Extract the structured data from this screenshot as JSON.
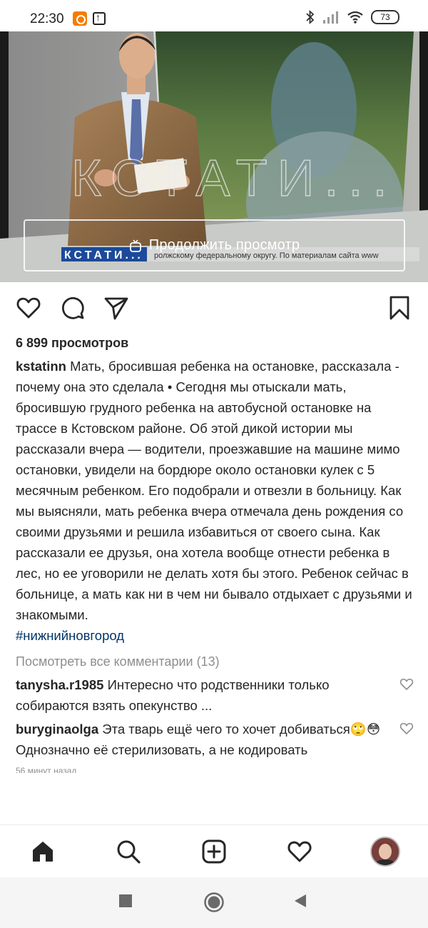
{
  "status_bar": {
    "time": "22:30",
    "battery": "73",
    "icons": [
      "app-notification-icon",
      "upload-icon",
      "bluetooth-icon",
      "signal-icon",
      "wifi-icon",
      "battery-icon"
    ]
  },
  "video": {
    "continue_label": "Продолжить просмотр",
    "watermark": "КСТАТИ...",
    "ticker_brand": "КСТАТИ...",
    "ticker_text": "ролжскому федеральному округу. По материалам сайта www"
  },
  "actions": {
    "icons": [
      "heart-icon",
      "comment-icon",
      "share-icon",
      "bookmark-icon"
    ]
  },
  "post": {
    "views": "6 899 просмотров",
    "username": "kstatinn",
    "caption": "Мать, бросившая ребенка на остановке, рассказала - почему она это сделала • Сегодня мы отыскали мать, бросившую грудного ребенка на автобусной остановке на трассе в Кстовском районе. Об этой дикой истории мы рассказали вчера — водители, проезжавшие на машине мимо остановки, увидели на бордюре около остановки кулек с 5 месячным ребенком. Его подобрали и отвезли в больницу. Как мы выясняли, мать ребенка вчера отмечала день рождения со своими друзьями и решила избавиться от своего сына. Как рассказали ее друзья, она хотела вообще отнести ребенка в лес, но ее уговорили не делать хотя бы этого. Ребенок сейчас в больнице, а мать как ни в чем ни бывало отдыхает с друзьями и знакомыми.",
    "hashtag": "#нижнийновгород",
    "view_all_comments": "Посмотреть все комментарии (13)",
    "comments": [
      {
        "user": "tanysha.r1985",
        "text": "Интересно что родственники только собираются взять опекунство ..."
      },
      {
        "user": "buryginaolga",
        "text": "Эта тварь ещё чего то хочет добиваться🙄😳 Однозначно её стерилизовать, а не кодировать"
      }
    ],
    "timestamp": "56 минут назад"
  },
  "bottom_nav": {
    "icons": [
      "home-icon",
      "search-icon",
      "add-post-icon",
      "activity-heart-icon",
      "profile-avatar"
    ]
  },
  "system_nav": {
    "icons": [
      "recents-square-icon",
      "home-circle-icon",
      "back-triangle-icon"
    ]
  },
  "colors": {
    "text": "#262626",
    "muted": "#8e8e8e",
    "hashtag": "#003569",
    "ticker_blue": "#1c4a9a"
  }
}
